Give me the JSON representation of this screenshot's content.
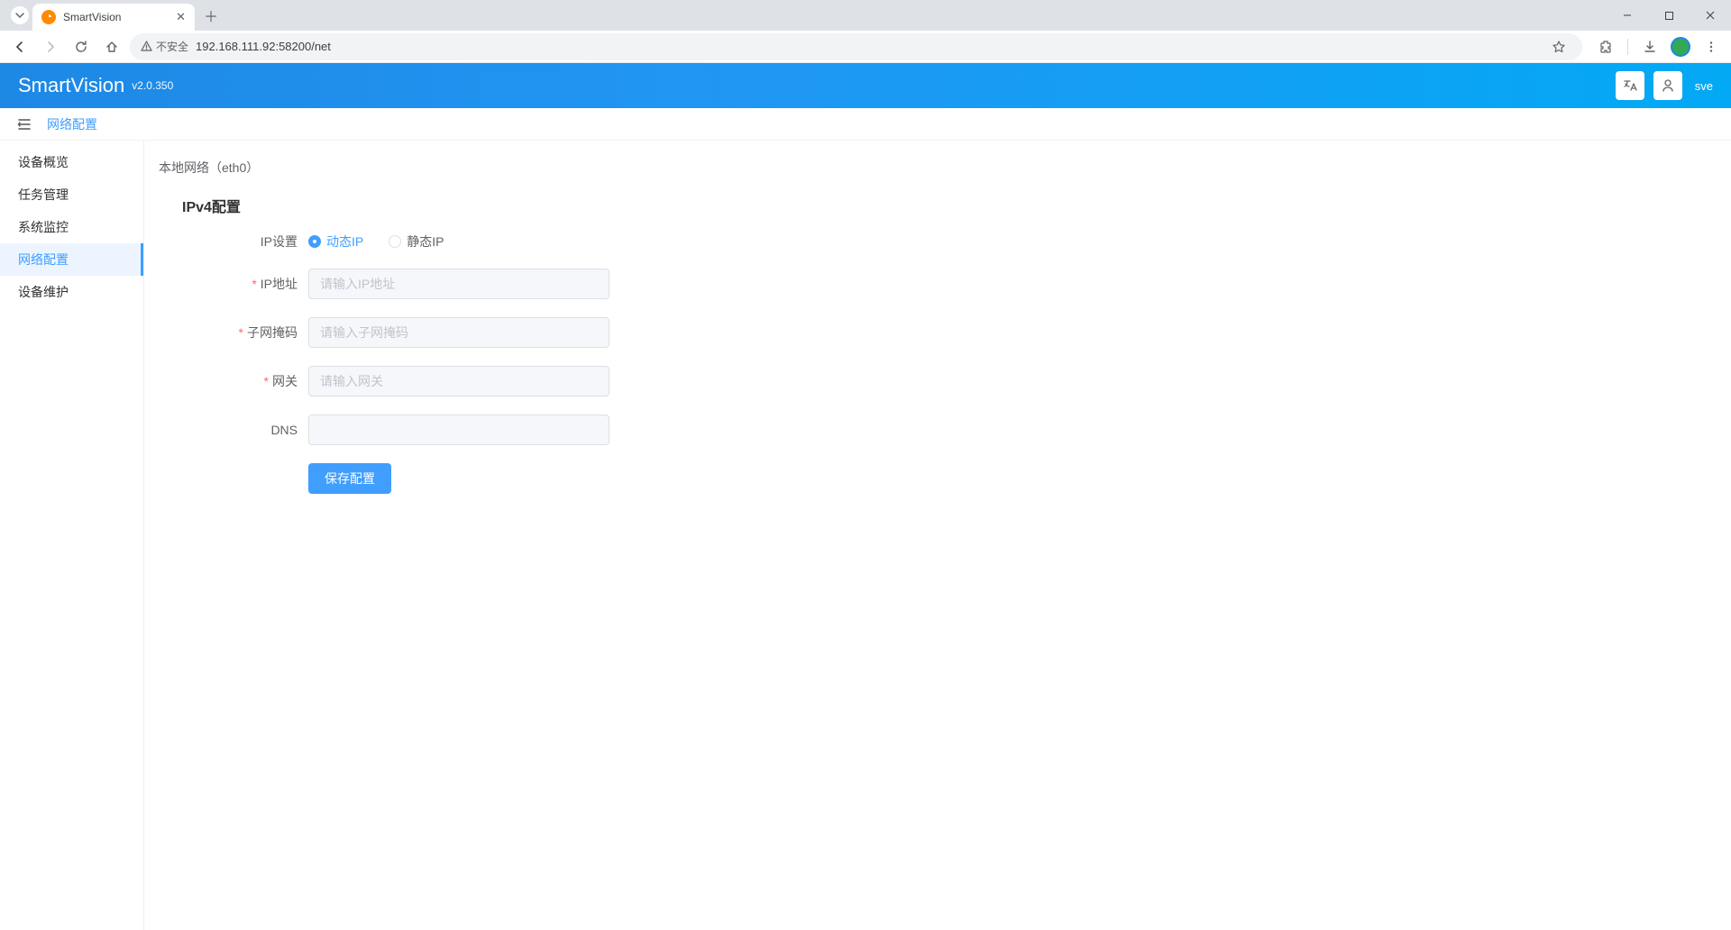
{
  "browser": {
    "tab_title": "SmartVision",
    "security_label": "不安全",
    "url": "192.168.111.92:58200/net"
  },
  "header": {
    "app_title": "SmartVision",
    "version": "v2.0.350",
    "user": "sve"
  },
  "breadcrumb": {
    "current": "网络配置"
  },
  "sidebar": {
    "items": [
      {
        "label": "设备概览"
      },
      {
        "label": "任务管理"
      },
      {
        "label": "系统监控"
      },
      {
        "label": "网络配置"
      },
      {
        "label": "设备维护"
      }
    ],
    "active_index": 3
  },
  "panel": {
    "title": "本地网络（eth0）",
    "section_title": "IPv4配置"
  },
  "form": {
    "ip_mode_label": "IP设置",
    "radio_dynamic": "动态IP",
    "radio_static": "静态IP",
    "fields": {
      "ip": {
        "label": "IP地址",
        "placeholder": "请输入IP地址",
        "required": true
      },
      "netmask": {
        "label": "子网掩码",
        "placeholder": "请输入子网掩码",
        "required": true
      },
      "gateway": {
        "label": "网关",
        "placeholder": "请输入网关",
        "required": true
      },
      "dns": {
        "label": "DNS",
        "placeholder": "",
        "required": false
      }
    },
    "save_label": "保存配置"
  }
}
